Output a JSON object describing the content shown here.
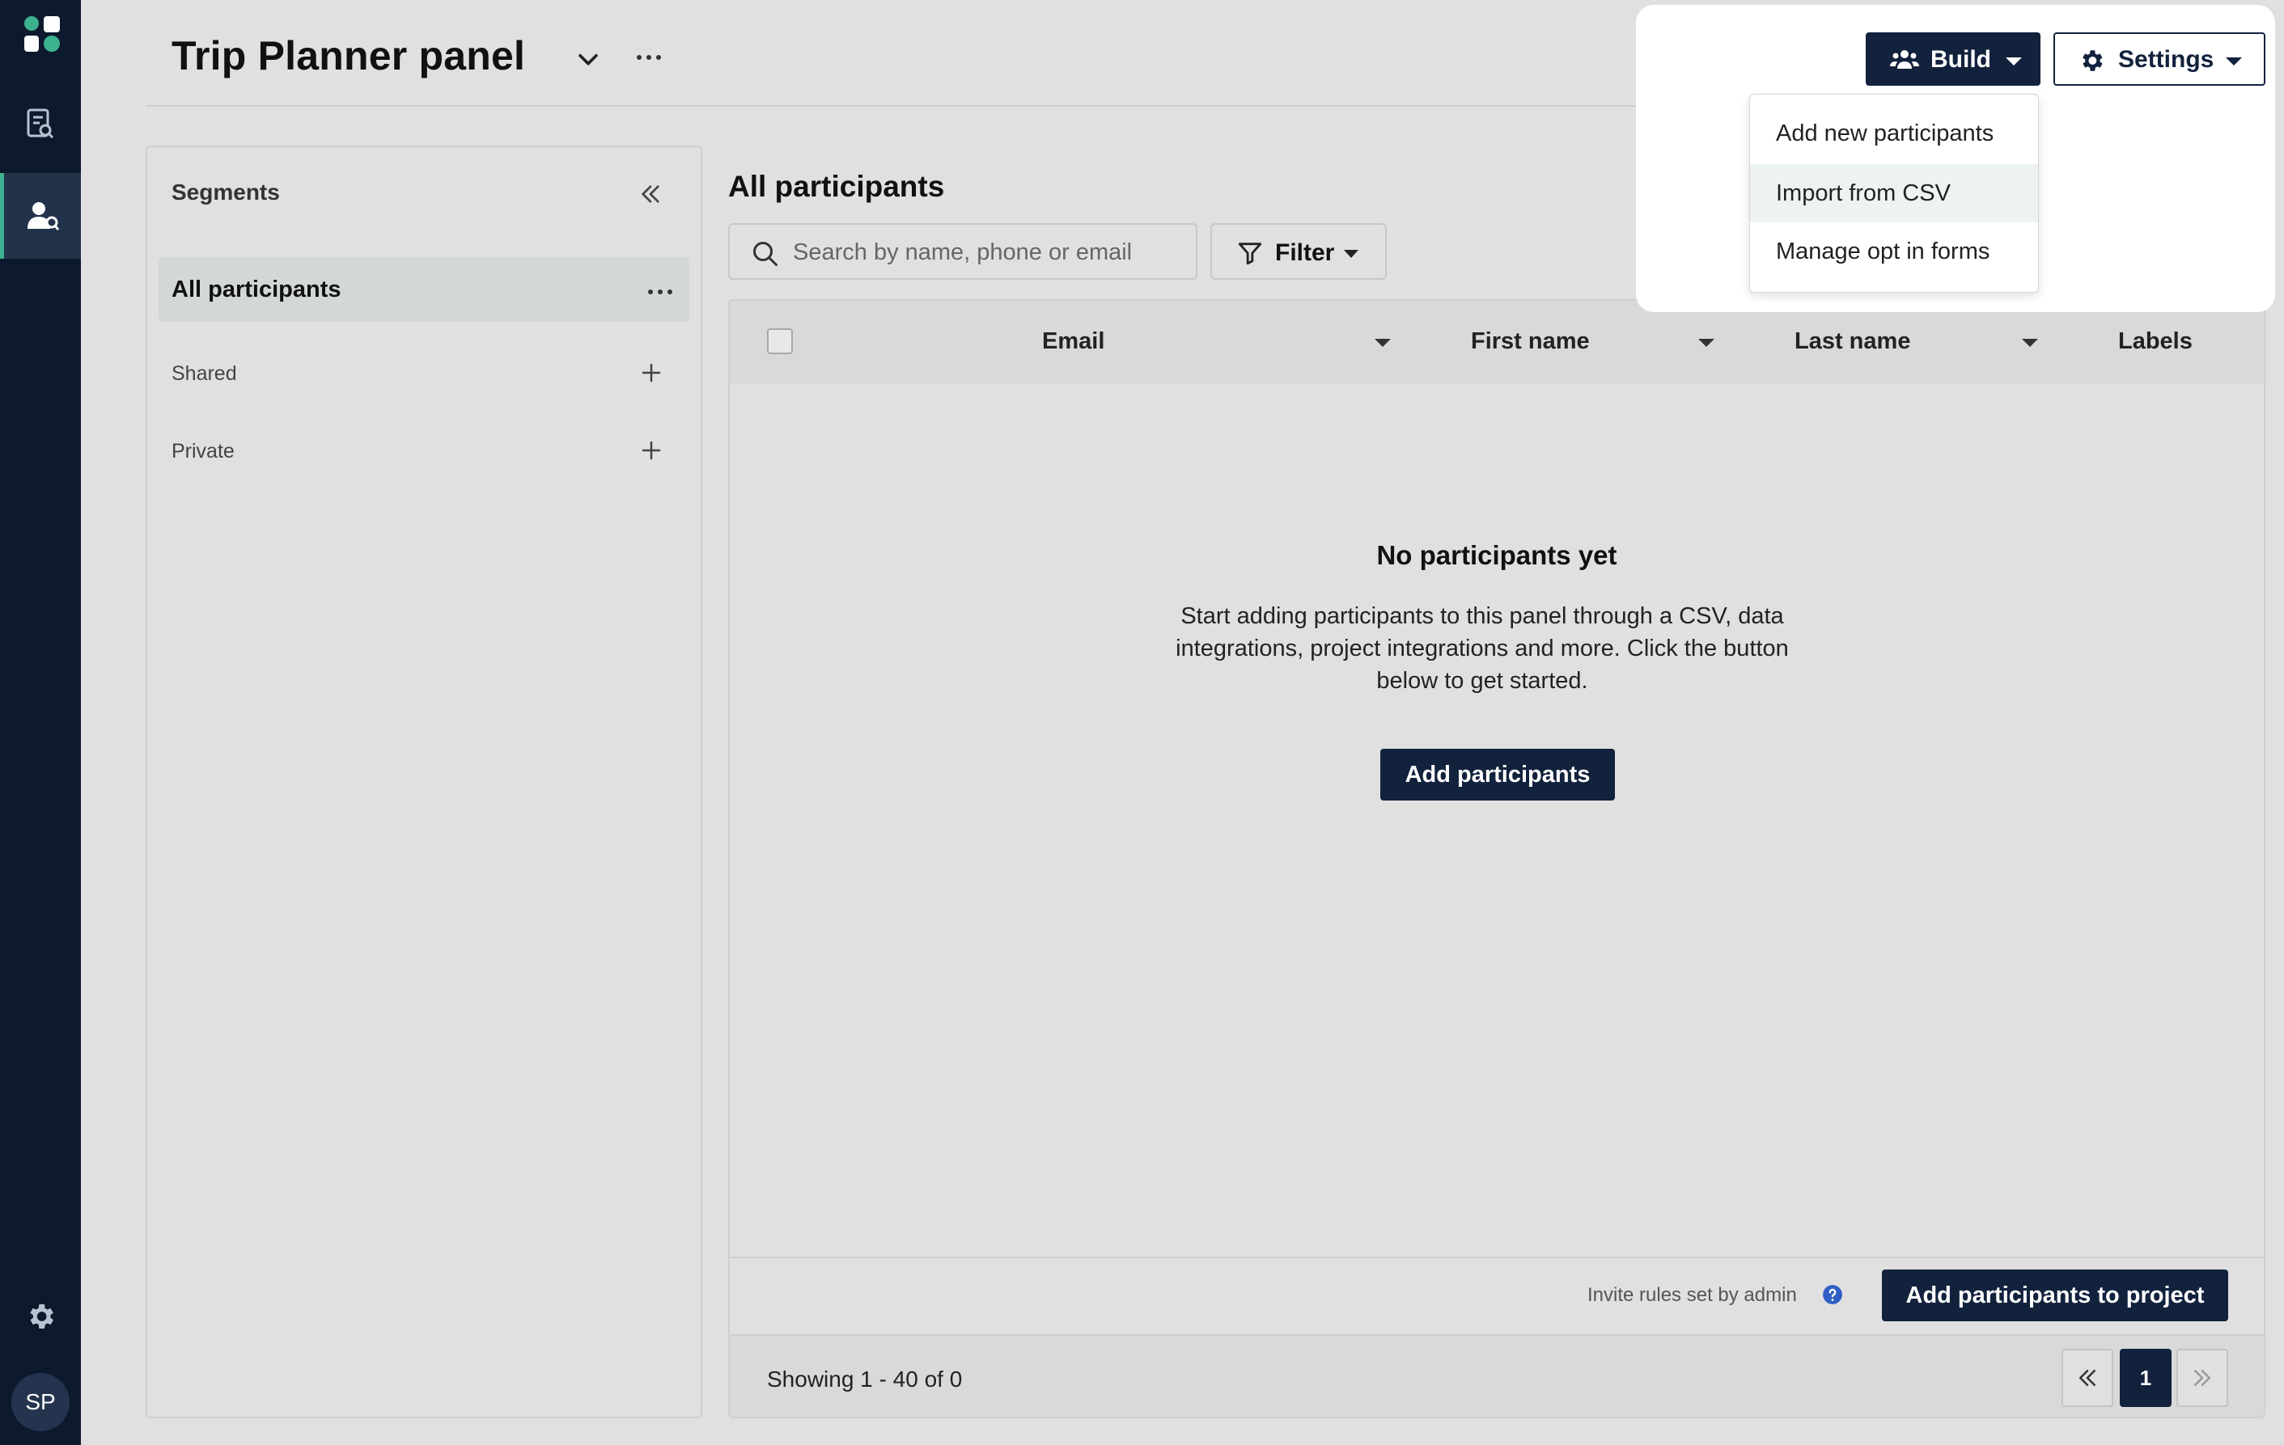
{
  "app": {
    "avatar_initials": "SP",
    "accent_color": "#3db28e",
    "brand_color": "#12223d",
    "rail_color": "#0d1a2d"
  },
  "header": {
    "title": "Trip Planner panel"
  },
  "toolbar": {
    "build_label": "Build",
    "settings_label": "Settings"
  },
  "build_menu": {
    "items": [
      {
        "label": "Add new participants"
      },
      {
        "label": "Import from CSV"
      },
      {
        "label": "Manage opt in forms"
      }
    ]
  },
  "segments": {
    "title": "Segments",
    "all_label": "All participants",
    "shared_label": "Shared",
    "private_label": "Private"
  },
  "main": {
    "title": "All participants",
    "search_placeholder": "Search by name, phone or email",
    "filter_label": "Filter",
    "columns": [
      "Email",
      "First name",
      "Last name",
      "Labels"
    ],
    "empty_title": "No participants yet",
    "empty_text": "Start adding participants to this panel through a CSV, data integrations, project integrations and more. Click the button below to get started.",
    "empty_button": "Add participants",
    "invite_rules": "Invite rules set by admin",
    "add_to_project_button": "Add participants to project",
    "showing": "Showing 1 - 40 of 0",
    "current_page": "1"
  }
}
